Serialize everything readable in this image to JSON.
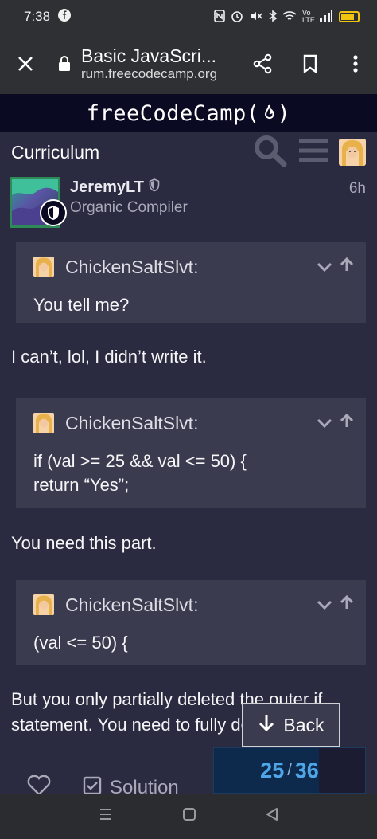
{
  "status_bar": {
    "time": "7:38",
    "icons": [
      "facebook-icon",
      "nfc-icon",
      "alarm-icon",
      "mute-icon",
      "bluetooth-icon",
      "wifi-icon",
      "volte-icon",
      "signal-icon",
      "battery-icon"
    ],
    "volte_label": "Vo LTE"
  },
  "browser": {
    "page_title": "Basic JavaScri...",
    "url": "rum.freecodecamp.org"
  },
  "banner": {
    "text_before": "freeCodeCamp(",
    "text_after": ")"
  },
  "nav": {
    "title": "Curriculum"
  },
  "post": {
    "username": "JeremyLT",
    "user_title": "Organic Compiler",
    "time": "6h",
    "quotes": [
      {
        "author": "ChickenSaltSlvt:",
        "lines": [
          "You tell me?"
        ]
      },
      {
        "author": "ChickenSaltSlvt:",
        "lines": [
          "if (val >= 25 && val <= 50) {",
          "return “Yes”;"
        ]
      },
      {
        "author": "ChickenSaltSlvt:",
        "lines": [
          "(val <= 50) {"
        ]
      }
    ],
    "paragraphs": [
      "I can’t, lol, I didn’t write it.",
      "You need this part.",
      "But you only partially deleted the outer if statement. You need to fully delete it."
    ]
  },
  "back_button": {
    "label": "Back"
  },
  "actions": {
    "solution_label": "Solution"
  },
  "progress": {
    "current": "25",
    "separator": "/",
    "total": "36",
    "fraction": 0.694
  },
  "colors": {
    "accent": "#4ea6e8",
    "banner_bg": "#0a0a23",
    "quote_bg": "#3b3b4f",
    "page_bg": "#2a2a40"
  }
}
